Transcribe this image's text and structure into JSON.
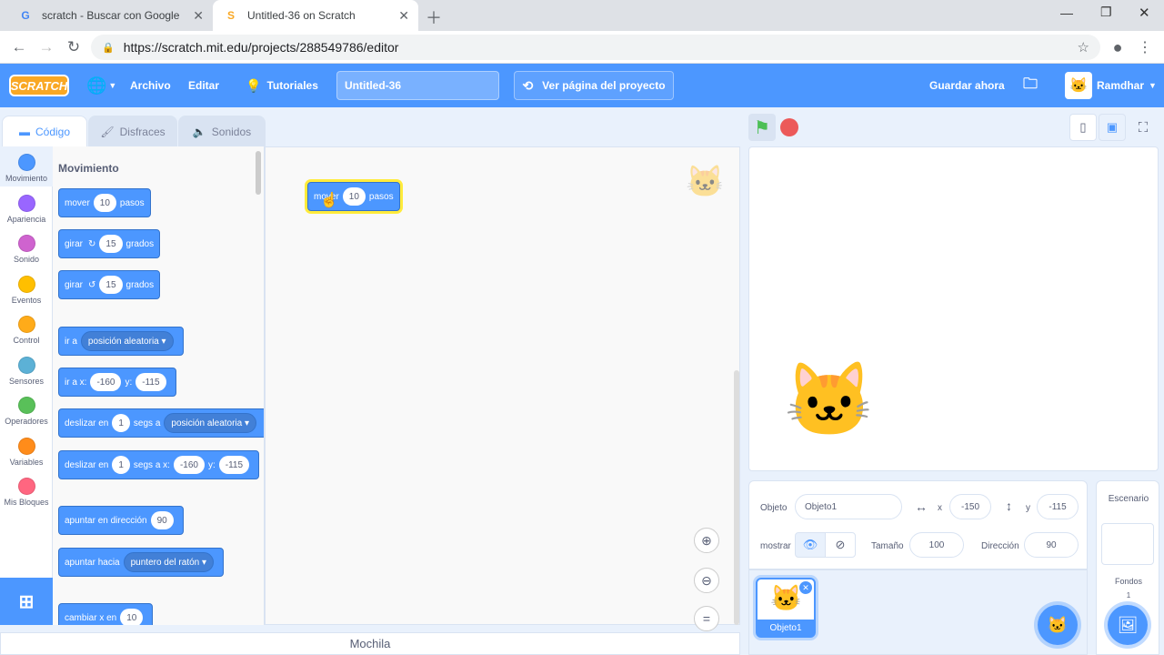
{
  "browser": {
    "tabs": [
      {
        "title": "scratch - Buscar con Google",
        "favicon": "G"
      },
      {
        "title": "Untitled-36 on Scratch",
        "favicon": "S"
      }
    ],
    "url": "https://scratch.mit.edu/projects/288549786/editor"
  },
  "menu": {
    "logo": "SCRATCH",
    "file": "Archivo",
    "edit": "Editar",
    "tutorials": "Tutoriales",
    "project_title": "Untitled-36",
    "see_project": "Ver página del proyecto",
    "save_now": "Guardar ahora",
    "username": "Ramdhar"
  },
  "editor_tabs": {
    "code": "Código",
    "costumes": "Disfraces",
    "sounds": "Sonidos"
  },
  "categories": [
    {
      "label": "Movimiento",
      "color": "#4c97ff"
    },
    {
      "label": "Apariencia",
      "color": "#9966ff"
    },
    {
      "label": "Sonido",
      "color": "#cf63cf"
    },
    {
      "label": "Eventos",
      "color": "#ffbf00"
    },
    {
      "label": "Control",
      "color": "#ffab19"
    },
    {
      "label": "Sensores",
      "color": "#5cb1d6"
    },
    {
      "label": "Operadores",
      "color": "#59c059"
    },
    {
      "label": "Variables",
      "color": "#ff8c1a"
    },
    {
      "label": "Mis Bloques",
      "color": "#ff6680"
    }
  ],
  "palette": {
    "heading": "Movimiento",
    "b_move": {
      "a": "mover",
      "v": "10",
      "b": "pasos"
    },
    "b_turn_right": {
      "a": "girar",
      "v": "15",
      "b": "grados"
    },
    "b_turn_left": {
      "a": "girar",
      "v": "15",
      "b": "grados"
    },
    "b_goto": {
      "a": "ir a",
      "d": "posición aleatoria"
    },
    "b_gotoxy": {
      "a": "ir a x:",
      "x": "-160",
      "b": "y:",
      "y": "-115"
    },
    "b_glide": {
      "a": "deslizar en",
      "v": "1",
      "b": "segs a",
      "d": "posición aleatoria"
    },
    "b_glidexy": {
      "a": "deslizar en",
      "v": "1",
      "b": "segs a x:",
      "x": "-160",
      "c": "y:",
      "y": "-115"
    },
    "b_point": {
      "a": "apuntar en dirección",
      "v": "90"
    },
    "b_pointto": {
      "a": "apuntar hacia",
      "d": "puntero del ratón"
    },
    "b_changex": {
      "a": "cambiar x en",
      "v": "10"
    }
  },
  "script_block": {
    "a": "mover",
    "v": "10",
    "b": "pasos"
  },
  "backpack": "Mochila",
  "sprite_info": {
    "sprite_label": "Objeto",
    "sprite_name": "Objeto1",
    "x_label": "x",
    "x": "-150",
    "y_label": "y",
    "y": "-115",
    "show_label": "mostrar",
    "size_label": "Tamaño",
    "size": "100",
    "direction_label": "Dirección",
    "direction": "90"
  },
  "sprite_list": [
    {
      "name": "Objeto1"
    }
  ],
  "stage_panel": {
    "title": "Escenario",
    "backdrops_label": "Fondos",
    "backdrops_count": "1"
  }
}
